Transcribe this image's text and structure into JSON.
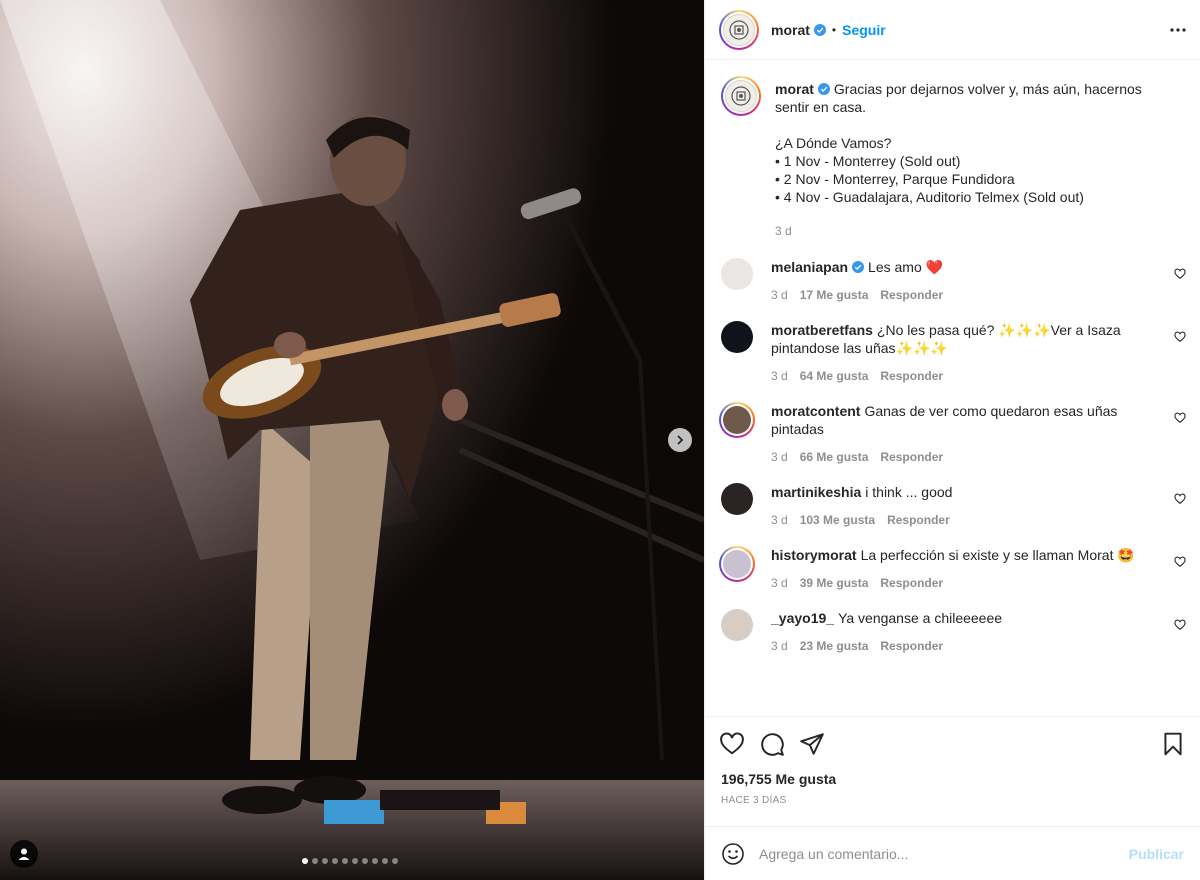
{
  "post": {
    "username": "morat",
    "follow_label": "Seguir",
    "separator": "•",
    "brand_color": "#0095f6",
    "carousel": {
      "slides": 10,
      "current": 1
    }
  },
  "caption": {
    "username": "morat",
    "text": "Gracias por dejarnos volver y, más aún, hacernos sentir en casa.\n\n¿A Dónde Vamos?\n• 1 Nov - Monterrey (Sold out)\n• 2 Nov - Monterrey, Parque Fundidora\n• 4 Nov - Guadalajara, Auditorio Telmex (Sold out)",
    "age": "3 d"
  },
  "comments": [
    {
      "username": "melaniapan",
      "verified": true,
      "text": "Les amo ❤️",
      "age": "3 d",
      "likes": "17 Me gusta",
      "reply": "Responder"
    },
    {
      "username": "moratberetfans",
      "verified": false,
      "text": "¿No les pasa qué? ✨✨✨Ver a Isaza pintandose las uñas✨✨✨",
      "age": "3 d",
      "likes": "64 Me gusta",
      "reply": "Responder"
    },
    {
      "username": "moratcontent",
      "verified": false,
      "text": "Ganas de ver como quedaron esas uñas pintadas",
      "age": "3 d",
      "likes": "66 Me gusta",
      "reply": "Responder"
    },
    {
      "username": "martinikeshia",
      "verified": false,
      "text": "i think ... good",
      "age": "3 d",
      "likes": "103 Me gusta",
      "reply": "Responder"
    },
    {
      "username": "historymorat",
      "verified": false,
      "text": "La perfección si existe y se llaman Morat 🤩",
      "age": "3 d",
      "likes": "39 Me gusta",
      "reply": "Responder"
    },
    {
      "username": "_yayo19_",
      "verified": false,
      "text": "Ya venganse a chileeeeee",
      "age": "3 d",
      "likes": "23 Me gusta",
      "reply": "Responder"
    }
  ],
  "stats": {
    "likes": "196,755 Me gusta",
    "posted": "HACE 3 DÍAS"
  },
  "add_comment": {
    "placeholder": "Agrega un comentario...",
    "publish_label": "Publicar"
  }
}
